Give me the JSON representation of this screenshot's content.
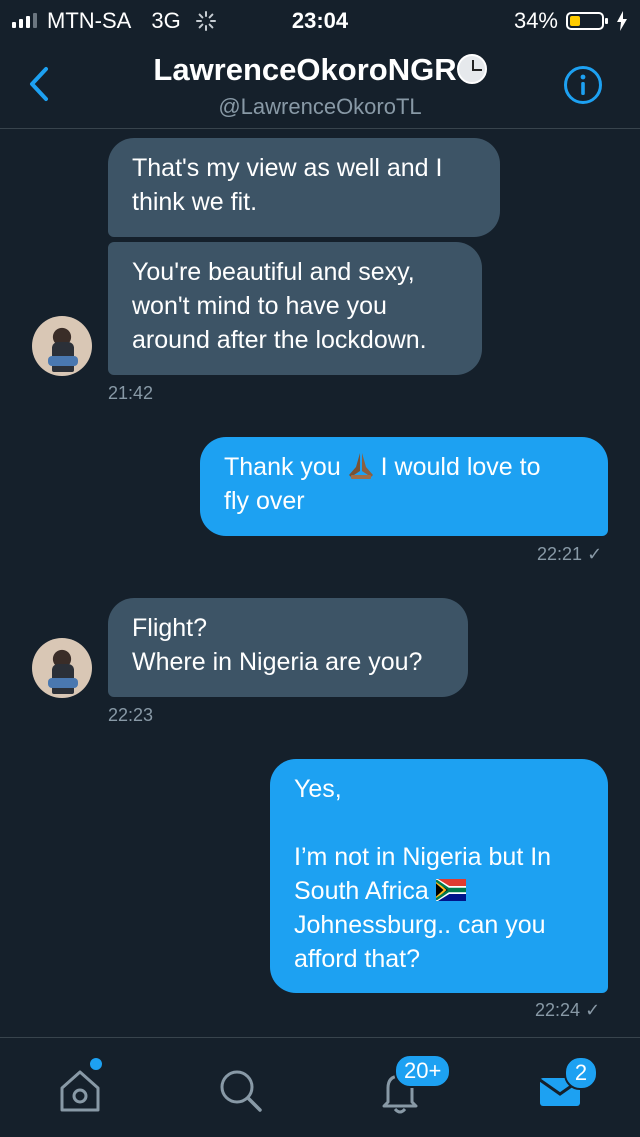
{
  "status_bar": {
    "carrier": "MTN-SA",
    "network": "3G",
    "time": "23:04",
    "battery_percent": "34%",
    "battery_level": 0.34
  },
  "header": {
    "title": "LawrenceOkoroNGR",
    "handle": "@LawrenceOkoroTL",
    "title_emoji": "clock-emoji"
  },
  "messages": [
    {
      "side": "received",
      "text": "That's my view as well and I\nthink we fit."
    },
    {
      "side": "received",
      "text": "You're beautiful and sexy,\nwon't mind to have you\naround after the lockdown.",
      "timestamp": "21:42"
    },
    {
      "side": "sent",
      "text_before": "Thank you",
      "emoji": "folded-hands",
      "text_after": "I would love to\nfly over",
      "timestamp": "22:21"
    },
    {
      "side": "received",
      "text": "Flight?\nWhere in Nigeria are you?",
      "timestamp": "22:23"
    },
    {
      "side": "sent",
      "text_before": "Yes,\n\nI’m not in Nigeria but In\nSouth Africa",
      "emoji": "south-africa-flag",
      "text_after": "\nJohnessburg.. can you\nafford that?",
      "timestamp": "22:24"
    }
  ],
  "tabbar": {
    "notifications_badge": "20+",
    "messages_badge": "2",
    "icons": [
      "home-icon",
      "search-icon",
      "bell-icon",
      "mail-icon"
    ]
  },
  "colors": {
    "background": "#15202b",
    "received_bubble": "#3d5466",
    "sent_bubble": "#1da1f2",
    "accent": "#1da1f2",
    "muted_text": "#8899a6"
  }
}
